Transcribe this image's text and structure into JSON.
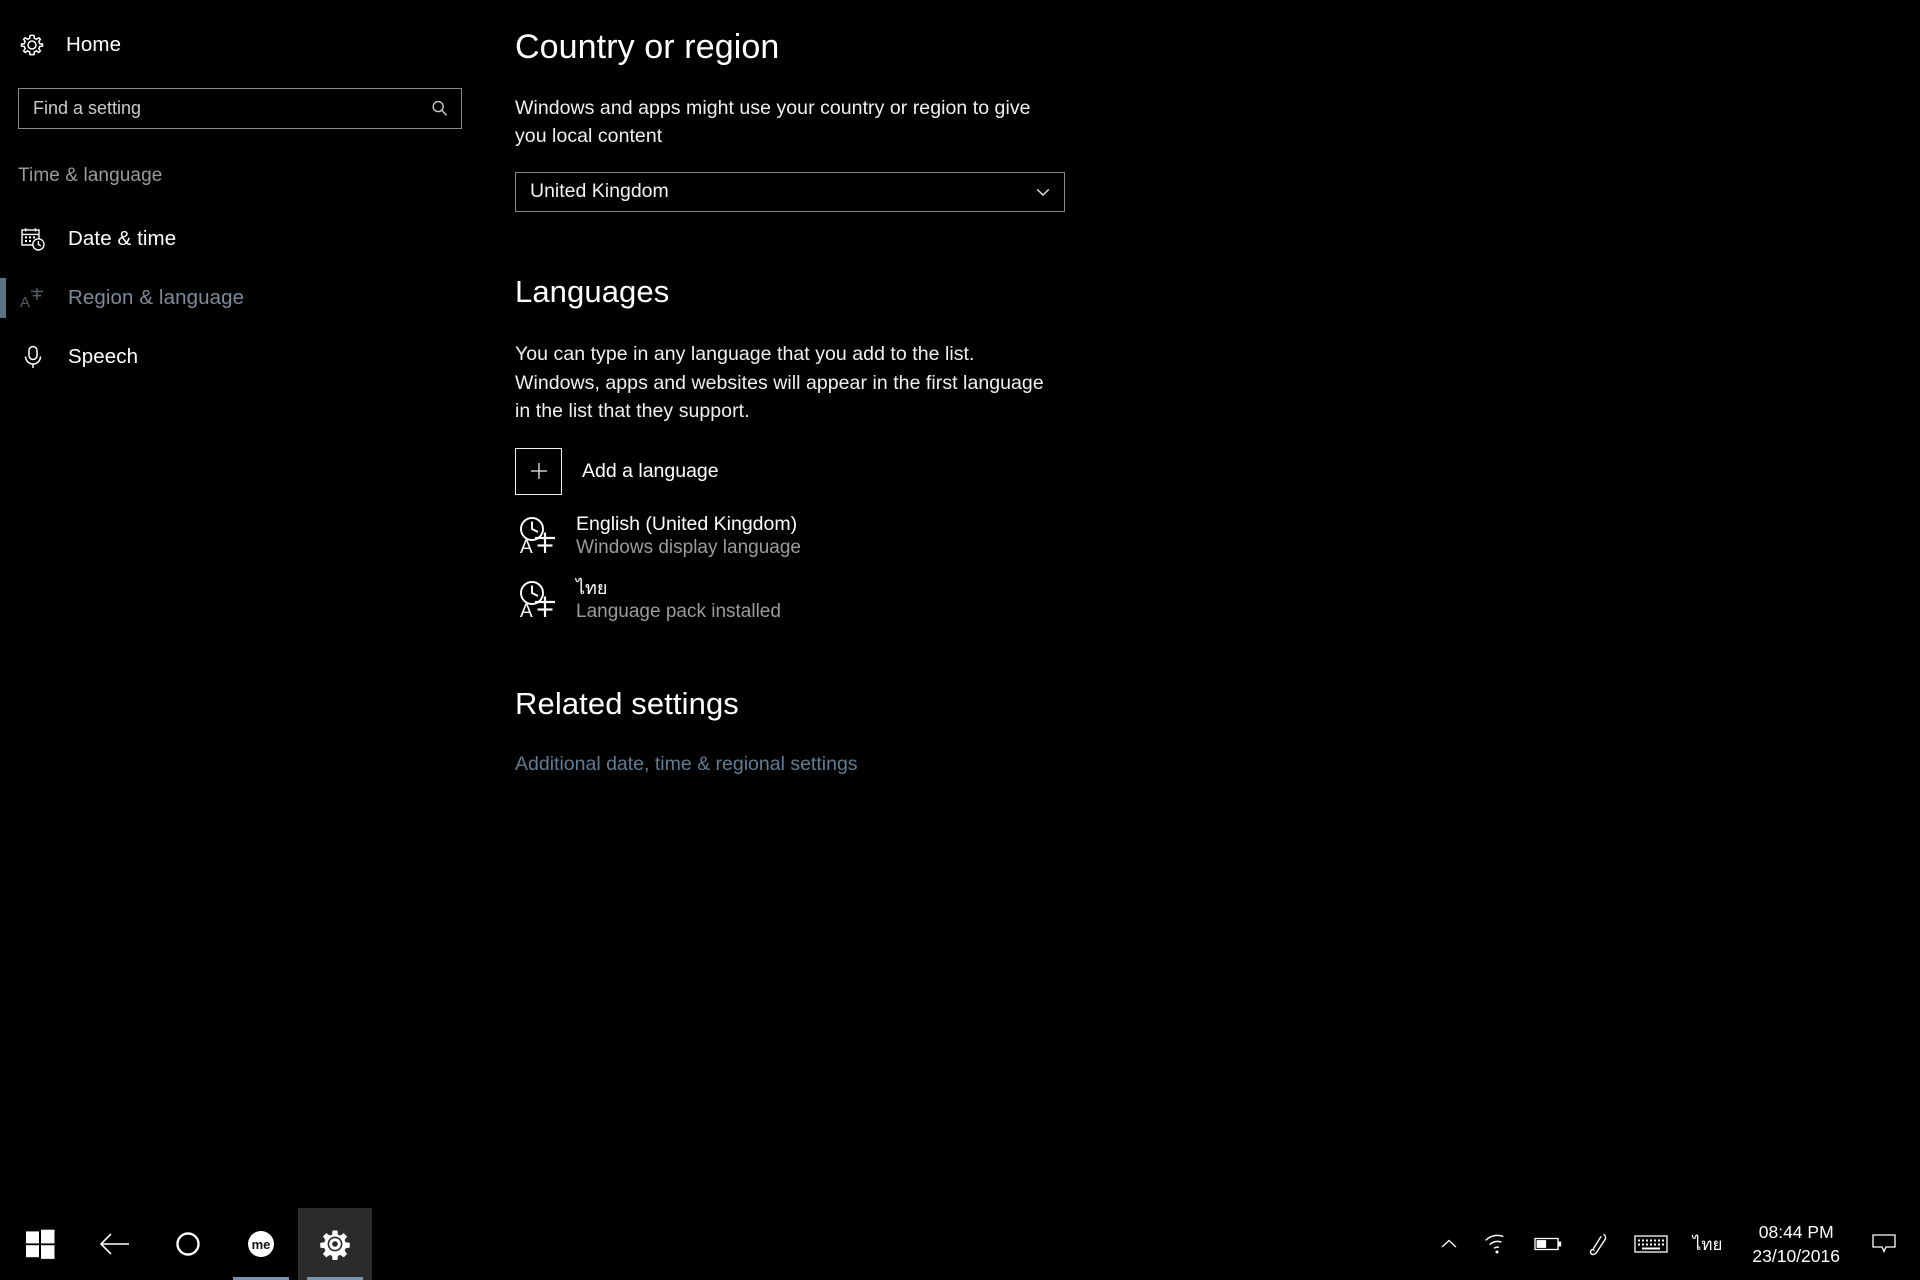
{
  "sidebar": {
    "home": {
      "label": "Home",
      "icon": "gear-icon"
    },
    "search": {
      "placeholder": "Find a setting",
      "value": "",
      "icon": "search-icon"
    },
    "group_title": "Time & language",
    "items": [
      {
        "label": "Date & time",
        "icon": "calendar-clock-icon",
        "selected": false
      },
      {
        "label": "Region & language",
        "icon": "language-icon",
        "selected": true
      },
      {
        "label": "Speech",
        "icon": "microphone-icon",
        "selected": false
      }
    ]
  },
  "main": {
    "country": {
      "title": "Country or region",
      "description": "Windows and apps might use your country or region to give you local content",
      "dropdown_value": "United Kingdom",
      "dropdown_icon": "chevron-down-icon"
    },
    "languages": {
      "title": "Languages",
      "description": "You can type in any language that you add to the list. Windows, apps and websites will appear in the first language in the list that they support.",
      "add_label": "Add a language",
      "add_icon": "plus-icon",
      "items": [
        {
          "name": "English (United Kingdom)",
          "status": "Windows display language",
          "icon": "language-clock-icon",
          "thai": false
        },
        {
          "name": "ไทย",
          "status": "Language pack installed",
          "icon": "language-clock-icon",
          "thai": true
        }
      ]
    },
    "related": {
      "title": "Related settings",
      "link": "Additional date, time & regional settings"
    }
  },
  "taskbar": {
    "start": {
      "icon": "windows-logo-icon"
    },
    "back": {
      "icon": "back-arrow-icon"
    },
    "cortana": {
      "icon": "cortana-circle-icon"
    },
    "apps": [
      {
        "icon": "me-badge-icon",
        "name": "me-app",
        "active": false,
        "underline": true
      },
      {
        "icon": "gear-icon",
        "name": "settings-app",
        "active": true,
        "underline": true
      }
    ],
    "tray": [
      {
        "icon": "chevron-up-icon",
        "name": "show-hidden-icons"
      },
      {
        "icon": "wifi-icon",
        "name": "network"
      },
      {
        "icon": "battery-icon",
        "name": "battery"
      },
      {
        "icon": "pen-icon",
        "name": "windows-ink"
      },
      {
        "icon": "keyboard-icon",
        "name": "touch-keyboard"
      }
    ],
    "input_language": "ไทย",
    "clock": {
      "time": "08:44 PM",
      "date": "23/10/2016"
    },
    "action_center": {
      "icon": "notification-icon"
    }
  },
  "colors": {
    "background": "#000000",
    "accent": "#5b7285",
    "link": "#5f7c95",
    "muted_text": "#9b9b9b",
    "border": "#8a8a8a"
  }
}
